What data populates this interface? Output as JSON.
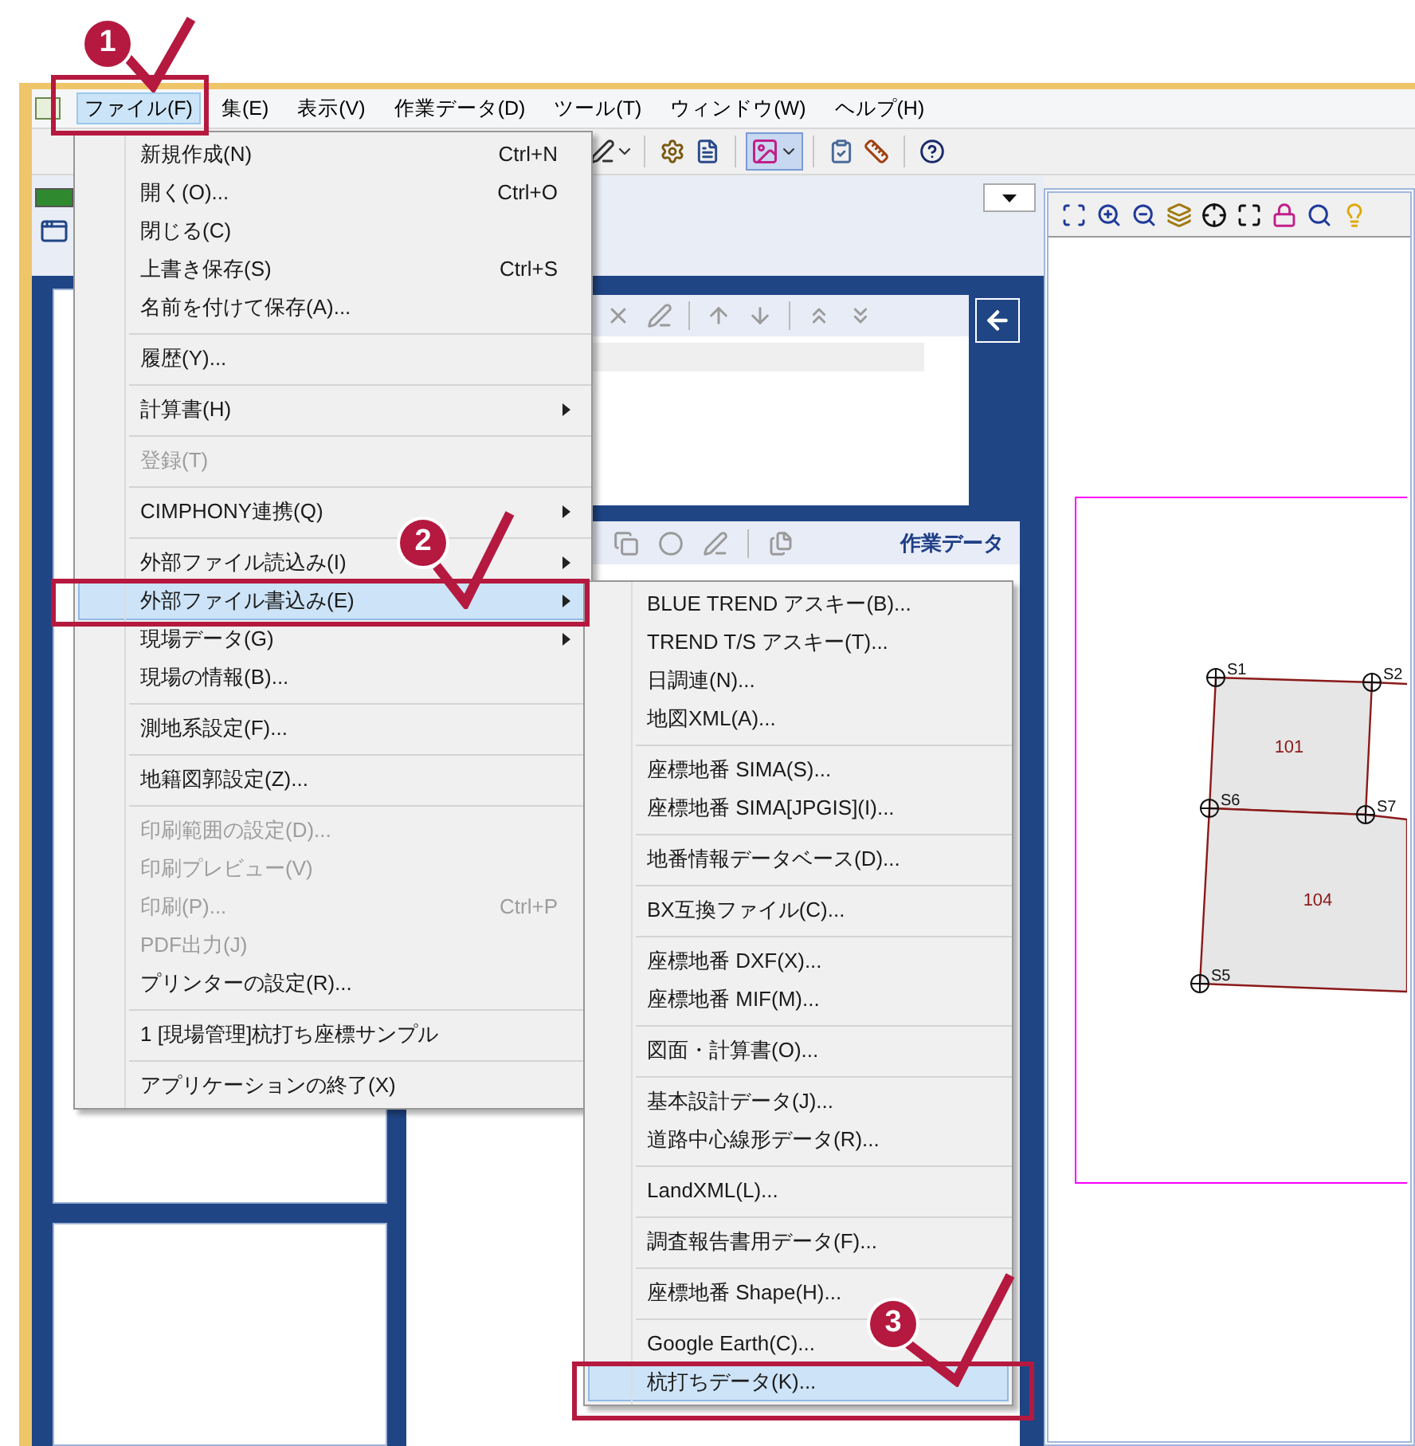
{
  "menu_bar": [
    {
      "label": "ファイル(F)",
      "selected": true
    },
    {
      "label": "集(E)",
      "selected": false
    },
    {
      "label": "表示(V)",
      "selected": false
    },
    {
      "label": "作業データ(D)",
      "selected": false
    },
    {
      "label": "ツール(T)",
      "selected": false
    },
    {
      "label": "ウィンドウ(W)",
      "selected": false
    },
    {
      "label": "ヘルプ(H)",
      "selected": false
    }
  ],
  "file_menu": [
    {
      "kind": "item",
      "label": "新規作成(N)",
      "shortcut": "Ctrl+N",
      "disabled": false,
      "submenu": false,
      "selected": false
    },
    {
      "kind": "item",
      "label": "開く(O)...",
      "shortcut": "Ctrl+O",
      "disabled": false,
      "submenu": false,
      "selected": false
    },
    {
      "kind": "item",
      "label": "閉じる(C)",
      "disabled": false,
      "submenu": false,
      "selected": false
    },
    {
      "kind": "item",
      "label": "上書き保存(S)",
      "shortcut": "Ctrl+S",
      "disabled": false,
      "submenu": false,
      "selected": false
    },
    {
      "kind": "item",
      "label": "名前を付けて保存(A)...",
      "disabled": false,
      "submenu": false,
      "selected": false
    },
    {
      "kind": "separator"
    },
    {
      "kind": "item",
      "label": "履歴(Y)...",
      "disabled": false,
      "submenu": false,
      "selected": false
    },
    {
      "kind": "separator"
    },
    {
      "kind": "item",
      "label": "計算書(H)",
      "disabled": false,
      "submenu": true,
      "selected": false
    },
    {
      "kind": "separator"
    },
    {
      "kind": "item",
      "label": "登録(T)",
      "disabled": true,
      "submenu": false,
      "selected": false
    },
    {
      "kind": "separator"
    },
    {
      "kind": "item",
      "label": "CIMPHONY連携(Q)",
      "disabled": false,
      "submenu": true,
      "selected": false
    },
    {
      "kind": "separator"
    },
    {
      "kind": "item",
      "label": "外部ファイル読込み(I)",
      "disabled": false,
      "submenu": true,
      "selected": false
    },
    {
      "kind": "item",
      "label": "外部ファイル書込み(E)",
      "disabled": false,
      "submenu": true,
      "selected": true
    },
    {
      "kind": "item",
      "label": "現場データ(G)",
      "disabled": false,
      "submenu": true,
      "selected": false
    },
    {
      "kind": "item",
      "label": "現場の情報(B)...",
      "disabled": false,
      "submenu": false,
      "selected": false
    },
    {
      "kind": "separator"
    },
    {
      "kind": "item",
      "label": "測地系設定(F)...",
      "disabled": false,
      "submenu": false,
      "selected": false
    },
    {
      "kind": "separator"
    },
    {
      "kind": "item",
      "label": "地籍図郭設定(Z)...",
      "disabled": false,
      "submenu": false,
      "selected": false
    },
    {
      "kind": "separator"
    },
    {
      "kind": "item",
      "label": "印刷範囲の設定(D)...",
      "disabled": true,
      "submenu": false,
      "selected": false
    },
    {
      "kind": "item",
      "label": "印刷プレビュー(V)",
      "disabled": true,
      "submenu": false,
      "selected": false
    },
    {
      "kind": "item",
      "label": "印刷(P)...",
      "shortcut": "Ctrl+P",
      "disabled": true,
      "submenu": false,
      "selected": false
    },
    {
      "kind": "item",
      "label": "PDF出力(J)",
      "disabled": true,
      "submenu": false,
      "selected": false
    },
    {
      "kind": "item",
      "label": "プリンターの設定(R)...",
      "disabled": false,
      "submenu": false,
      "selected": false
    },
    {
      "kind": "separator"
    },
    {
      "kind": "item",
      "label": "1 [現場管理]杭打ち座標サンプル",
      "disabled": false,
      "submenu": false,
      "selected": false
    },
    {
      "kind": "separator"
    },
    {
      "kind": "item",
      "label": "アプリケーションの終了(X)",
      "disabled": false,
      "submenu": false,
      "selected": false
    }
  ],
  "export_submenu": [
    {
      "kind": "item",
      "label": "BLUE TREND アスキー(B)...",
      "selected": false
    },
    {
      "kind": "item",
      "label": "TREND T/S アスキー(T)...",
      "selected": false
    },
    {
      "kind": "item",
      "label": "日調連(N)...",
      "selected": false
    },
    {
      "kind": "item",
      "label": "地図XML(A)...",
      "selected": false
    },
    {
      "kind": "separator"
    },
    {
      "kind": "item",
      "label": "座標地番 SIMA(S)...",
      "selected": false
    },
    {
      "kind": "item",
      "label": "座標地番 SIMA[JPGIS](I)...",
      "selected": false
    },
    {
      "kind": "separator"
    },
    {
      "kind": "item",
      "label": "地番情報データベース(D)...",
      "selected": false
    },
    {
      "kind": "separator"
    },
    {
      "kind": "item",
      "label": "BX互換ファイル(C)...",
      "selected": false
    },
    {
      "kind": "separator"
    },
    {
      "kind": "item",
      "label": "座標地番 DXF(X)...",
      "selected": false
    },
    {
      "kind": "item",
      "label": "座標地番 MIF(M)...",
      "selected": false
    },
    {
      "kind": "separator"
    },
    {
      "kind": "item",
      "label": "図面・計算書(O)...",
      "selected": false
    },
    {
      "kind": "separator"
    },
    {
      "kind": "item",
      "label": "基本設計データ(J)...",
      "selected": false
    },
    {
      "kind": "item",
      "label": "道路中心線形データ(R)...",
      "selected": false
    },
    {
      "kind": "separator"
    },
    {
      "kind": "item",
      "label": "LandXML(L)...",
      "selected": false
    },
    {
      "kind": "separator"
    },
    {
      "kind": "item",
      "label": "調査報告書用データ(F)...",
      "selected": false
    },
    {
      "kind": "separator"
    },
    {
      "kind": "item",
      "label": "座標地番 Shape(H)...",
      "selected": false
    },
    {
      "kind": "separator"
    },
    {
      "kind": "item",
      "label": "Google Earth(C)...",
      "selected": false
    },
    {
      "kind": "item",
      "label": "杭打ちデータ(K)...",
      "selected": true
    }
  ],
  "work_panel": {
    "title": "作業データ"
  },
  "map": {
    "parcels": [
      {
        "label": "101"
      },
      {
        "label": "104"
      }
    ],
    "points": [
      {
        "label": "S1"
      },
      {
        "label": "S2"
      },
      {
        "label": "S6"
      },
      {
        "label": "S7"
      },
      {
        "label": "S5"
      }
    ]
  },
  "annotations": [
    {
      "number": "1"
    },
    {
      "number": "2"
    },
    {
      "number": "3"
    }
  ]
}
